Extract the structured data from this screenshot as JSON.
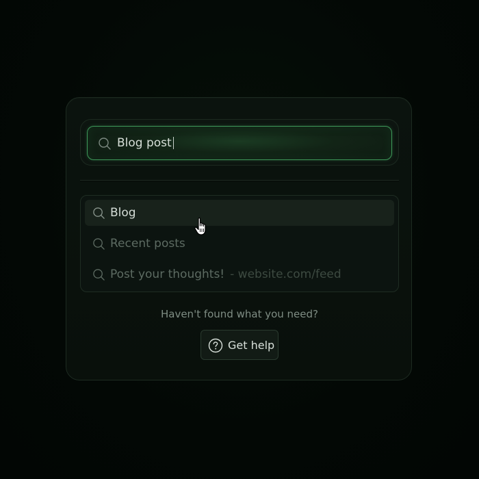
{
  "search": {
    "value": "Blog post",
    "icon": "search-icon"
  },
  "results": [
    {
      "label": "Blog",
      "sub": "",
      "icon": "search-icon",
      "active": true
    },
    {
      "label": "Recent posts",
      "sub": "",
      "icon": "search-icon",
      "active": false
    },
    {
      "label": "Post your thoughts!",
      "sub": "- website.com/feed",
      "icon": "search-icon",
      "active": false
    }
  ],
  "footer": {
    "help_prompt": "Haven't found what you need?",
    "help_button_label": "Get help",
    "help_icon": "question-circle-icon"
  },
  "colors": {
    "accent": "#3f9a5a",
    "background": "#020a05",
    "card": "#0b130e"
  }
}
